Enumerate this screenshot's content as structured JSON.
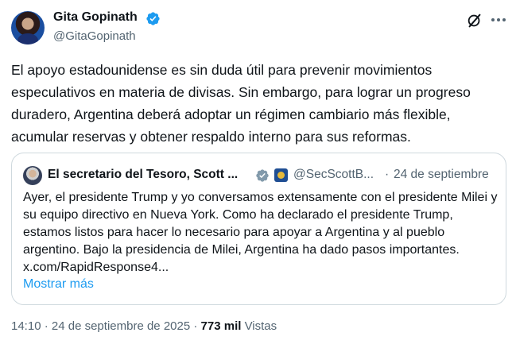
{
  "author": {
    "name": "Gita Gopinath",
    "handle": "@GitaGopinath"
  },
  "tweet": {
    "text": "El apoyo estadounidense es sin duda útil para prevenir movimientos especulativos en materia de divisas. Sin embargo, para lograr un progreso duradero, Argentina deberá adoptar un régimen cambiario más flexible, acumular reservas y obtener respaldo interno para sus reformas."
  },
  "quoted": {
    "name": "El secretario del Tesoro, Scott ...",
    "handle": "@SecScottB...",
    "separator": "·",
    "date": "24 de septiembre",
    "text": "Ayer, el presidente Trump y yo conversamos extensamente con el presidente Milei y su equipo directivo en Nueva York. Como ha declarado el presidente Trump, estamos listos para hacer lo necesario para apoyar a Argentina y al pueblo argentino. Bajo la presidencia de Milei, Argentina ha dado pasos importantes. x.com/RapidResponse4...",
    "show_more": "Mostrar más"
  },
  "meta": {
    "time": "14:10",
    "separator": "·",
    "date": "24 de septiembre de 2025",
    "views_count": "773 mil",
    "views_label": "Vistas"
  },
  "colors": {
    "verified": "#1d9bf0",
    "link": "#1d9bf0",
    "secondary_text": "#536471"
  },
  "icons": [
    "verified-badge-icon",
    "grok-icon",
    "more-icon",
    "government-badge-icon"
  ]
}
